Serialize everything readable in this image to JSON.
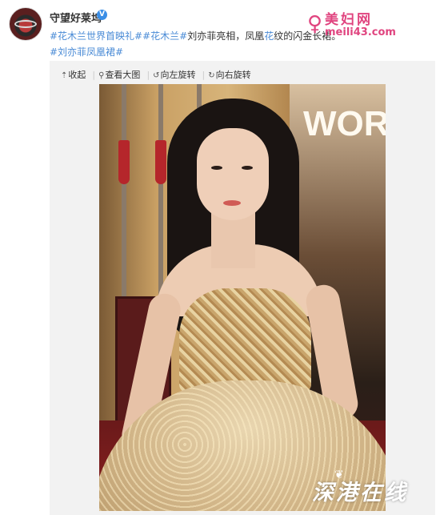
{
  "post": {
    "username": "守望好莱坞",
    "verified_mark": "V",
    "text_parts": [
      {
        "kind": "tag",
        "text": "#花木兰世界首映礼#"
      },
      {
        "kind": "tag",
        "text": "#花木兰#"
      },
      {
        "kind": "plain",
        "text": "刘亦菲亮相，凤凰"
      },
      {
        "kind": "tag",
        "text": "花"
      },
      {
        "kind": "plain",
        "text": "纹的闪金长裙。"
      }
    ],
    "tag_line": "#刘亦菲凤凰裙#"
  },
  "toolbar": {
    "collapse": {
      "icon": "collapse-icon",
      "label": "收起"
    },
    "view_large": {
      "icon": "magnifier-icon",
      "label": "查看大图"
    },
    "rotate_left": {
      "icon": "rotate-left-icon",
      "label": "向左旋转"
    },
    "rotate_right": {
      "icon": "rotate-right-icon",
      "label": "向右旋转"
    }
  },
  "photo": {
    "background_text": "WOR"
  },
  "watermarks": {
    "top_title": "美妇网",
    "top_url": "meili43.com",
    "bottom_text": "深港在线"
  },
  "colors": {
    "link": "#4a8bd6",
    "watermark_pink": "#e0447f",
    "panel_bg": "#f2f2f2",
    "verified": "#3a8ee6"
  }
}
